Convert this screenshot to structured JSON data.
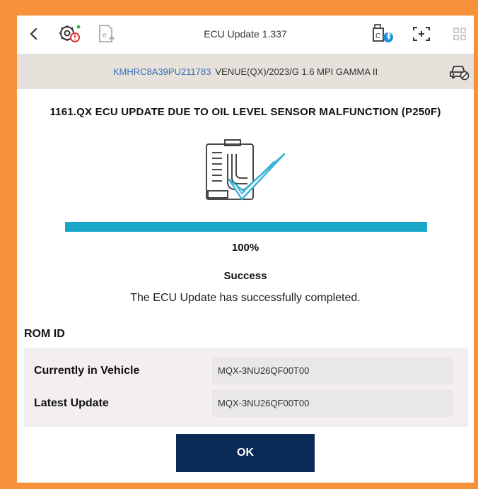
{
  "header": {
    "title": "ECU Update 1.337",
    "icons": [
      "back-arrow-icon",
      "gear-alert-icon",
      "e-upload-icon",
      "bluetooth-device-icon",
      "screenshot-icon",
      "grid-menu-icon"
    ]
  },
  "vehicle": {
    "vin": "KMHRC8A39PU211783",
    "description": "VENUE(QX)/2023/G 1.6 MPI GAMMA II",
    "icon": "car-check-icon"
  },
  "update": {
    "heading": "1161.QX ECU UPDATE DUE TO OIL LEVEL SENSOR MALFUNCTION (P250F)",
    "progress_percent": 100,
    "progress_label": "100%",
    "status": "Success",
    "message": "The ECU Update has successfully completed."
  },
  "rom": {
    "label": "ROM ID",
    "rows": [
      {
        "label": "Currently in Vehicle",
        "value": "MQX-3NU26QF00T00"
      },
      {
        "label": "Latest Update",
        "value": "MQX-3NU26QF00T00"
      }
    ]
  },
  "actions": {
    "ok_label": "OK"
  },
  "colors": {
    "frame": "#f7913a",
    "progress": "#1aa6c9",
    "button": "#0b2a55",
    "vin": "#3b6fb5",
    "check": "#3bb3d6"
  }
}
